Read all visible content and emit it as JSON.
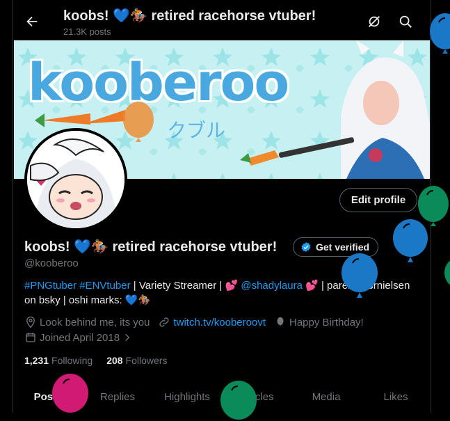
{
  "header": {
    "title": "koobs! 💙🏇 retired racehorse vtuber!",
    "post_count": "21.3K posts"
  },
  "banner": {
    "logo_text": "kooberoo",
    "logo_sub": "クブル"
  },
  "profile": {
    "name": "koobs! 💙🏇 retired racehorse vtuber!",
    "verify_label": "Get verified",
    "handle": "@kooberoo",
    "edit_label": "Edit profile"
  },
  "bio": {
    "hashtag1": "#PNGtuber",
    "hashtag2": "#ENVtuber",
    "text1": " | Variety Streamer | ",
    "heart1": "💕",
    "mention": "@shadylaura",
    "heart2": "💕",
    "text2": " | parent: s3rnielsen on bsky | oshi marks: ",
    "emoji": "💙🏇"
  },
  "meta": {
    "location": "Look behind me, its you",
    "website": "twitch.tv/kooberoovt",
    "birthday": "Happy Birthday!",
    "joined": "Joined April 2018"
  },
  "stats": {
    "following_count": "1,231",
    "following_label": "Following",
    "followers_count": "208",
    "followers_label": "Followers"
  },
  "tabs": [
    "Posts",
    "Replies",
    "Highlights",
    "Articles",
    "Media",
    "Likes"
  ],
  "colors": {
    "accent": "#1d9bf0",
    "balloon_blue": "#1b78c6",
    "balloon_green": "#0b8a5a",
    "balloon_pink": "#d01a73"
  }
}
